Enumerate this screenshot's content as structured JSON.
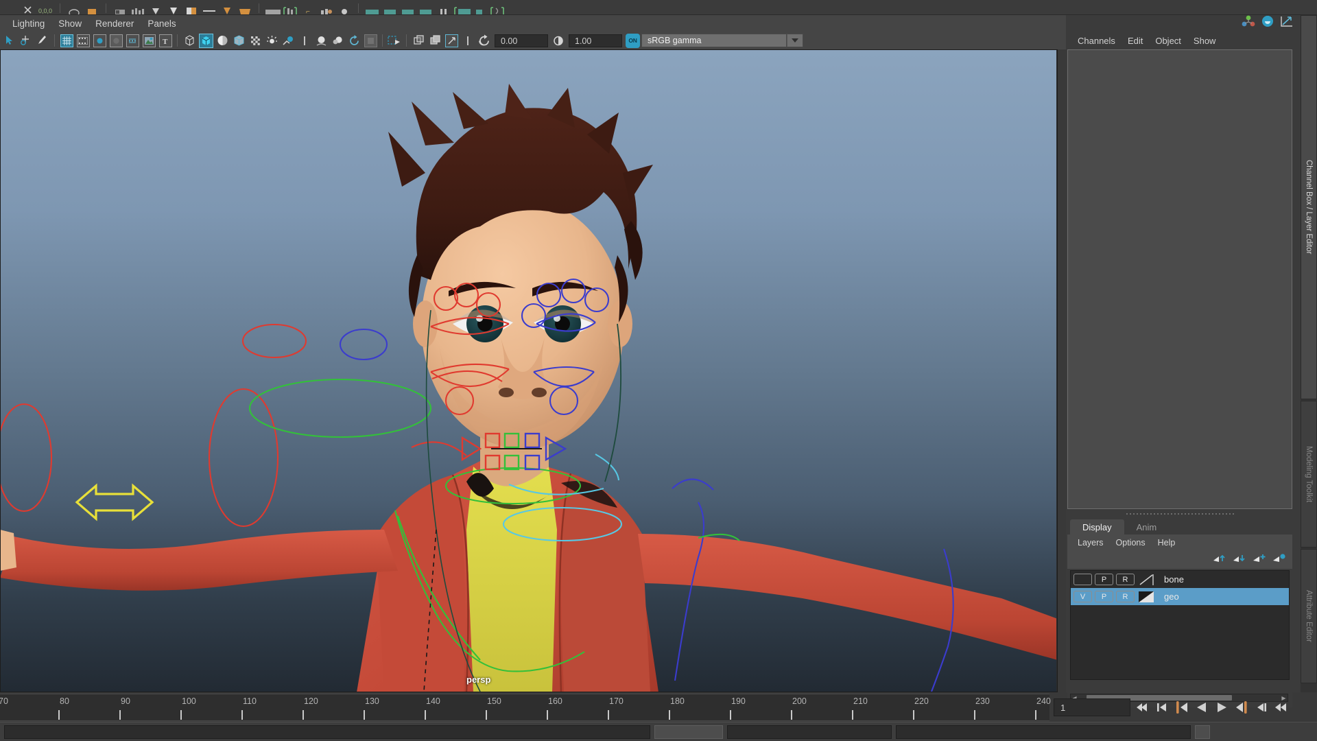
{
  "app": {
    "viewport_camera_label": "persp"
  },
  "top_cut_toolbar": {
    "icons": [
      "close-icon",
      "xyz-coords-icon",
      "divider",
      "circle-outline-icon",
      "orange-box-icon",
      "divider",
      "snap-grid-icon",
      "snap-points-icon",
      "arrow-down-icon",
      "arrow-down-solid-icon",
      "paint-bucket-icon",
      "line-icon",
      "arrow-down-orange-icon",
      "orange-block-icon",
      "divider",
      "render-view-icon",
      "render-region-icon",
      "divider",
      "ipr-icon",
      "render-settings-icon",
      "divider",
      "hypershade-icon",
      "render-a-icon",
      "render-b-icon",
      "render-c-icon",
      "render-d-icon",
      "divider",
      "green-bracket-icon",
      "teal-panel-icon",
      "divider",
      "green-bracket2-icon"
    ]
  },
  "panel_menubar": {
    "items": [
      {
        "label": "Lighting",
        "name": "menu-lighting"
      },
      {
        "label": "Show",
        "name": "menu-show"
      },
      {
        "label": "Renderer",
        "name": "menu-renderer"
      },
      {
        "label": "Panels",
        "name": "menu-panels"
      }
    ]
  },
  "viewport_toolbar": {
    "icons": [
      "select-tool-icon",
      "move-snap-icon",
      "paint-select-icon",
      "separator",
      "grid-display-icon",
      "film-gate-icon",
      "resolution-gate-icon",
      "gate-mask-icon",
      "film-origin-icon",
      "image-plane-icon",
      "text-hud-icon",
      "separator",
      "wireframe-icon",
      "smooth-shade-all-icon",
      "smooth-shade-flat-icon",
      "wireframe-on-shaded-icon",
      "textured-icon",
      "lighting-icon",
      "shadows-icon",
      "separator",
      "screen-space-ao-icon",
      "motion-blur-icon",
      "multisample-icon",
      "separator",
      "isolate-select-icon",
      "separator",
      "xray-icon",
      "xray-joints-icon",
      "xray-active-icon",
      "separator",
      "exposure-icon",
      "gamma-icon",
      "color-manage-toggle-icon"
    ],
    "exposure_value": "0.00",
    "gamma_value": "1.00",
    "color_management_toggle": "ON",
    "view_transform": "sRGB gamma",
    "dropdown_arrow_icon": "chevron-down-icon"
  },
  "channel_box": {
    "header_icons": [
      "show-manipulator-icon",
      "channel-box-toggle-icon",
      "graph-editor-icon"
    ],
    "menu_items": [
      {
        "label": "Channels",
        "name": "menu-channels"
      },
      {
        "label": "Edit",
        "name": "menu-edit"
      },
      {
        "label": "Object",
        "name": "menu-object"
      },
      {
        "label": "Show",
        "name": "menu-show-cb"
      }
    ]
  },
  "layer_editor": {
    "tabs": [
      {
        "label": "Display",
        "active": true
      },
      {
        "label": "Anim",
        "active": false
      }
    ],
    "menu_items": [
      {
        "label": "Layers",
        "name": "menu-layers"
      },
      {
        "label": "Options",
        "name": "menu-options"
      },
      {
        "label": "Help",
        "name": "menu-help"
      }
    ],
    "tool_icons": [
      "move-layer-up-icon",
      "move-layer-down-icon",
      "new-layer-icon",
      "new-layer-from-selected-icon"
    ],
    "layers": [
      {
        "visibility": "",
        "playback": "P",
        "reference": "R",
        "name": "bone",
        "selected": false,
        "swatch": "diagonal-light"
      },
      {
        "visibility": "V",
        "playback": "P",
        "reference": "R",
        "name": "geo",
        "selected": true,
        "swatch": "diagonal-dark"
      }
    ],
    "scrollbar": {
      "left_arrow_icon": "chevron-left-icon",
      "right_arrow_icon": "chevron-right-icon"
    }
  },
  "vertical_tabs": [
    {
      "label": "Channel Box / Layer Editor",
      "active": true
    },
    {
      "label": "Modeling Toolkit",
      "active": false
    },
    {
      "label": "Attribute Editor",
      "active": false
    }
  ],
  "time_slider": {
    "ticks": [
      70,
      80,
      90,
      100,
      110,
      120,
      130,
      140,
      150,
      160,
      170,
      180,
      190,
      200,
      210,
      220,
      230,
      240
    ],
    "current_frame": "1",
    "playback_buttons": [
      {
        "name": "go-to-start-button",
        "icon": "skip-to-start-icon"
      },
      {
        "name": "step-back-keyframe-button",
        "icon": "previous-keyframe-icon"
      },
      {
        "name": "step-back-frame-button",
        "icon": "previous-frame-icon"
      },
      {
        "name": "play-backwards-button",
        "icon": "play-backward-icon"
      },
      {
        "name": "play-forwards-button",
        "icon": "play-forward-icon"
      },
      {
        "name": "step-forward-frame-button",
        "icon": "next-frame-icon"
      },
      {
        "name": "step-forward-keyframe-button",
        "icon": "next-keyframe-icon"
      },
      {
        "name": "go-to-end-button",
        "icon": "skip-to-end-icon"
      }
    ]
  },
  "colors": {
    "accent_blue": "#5b9dc8",
    "toolbar_teal": "#2f9ec4",
    "panel_bg": "#3b3b3b",
    "menubar_bg": "#454545",
    "field_bg": "#2d2d2d",
    "selection_highlight": "#5b9dc8",
    "playhead_orange": "#d08a4e"
  }
}
